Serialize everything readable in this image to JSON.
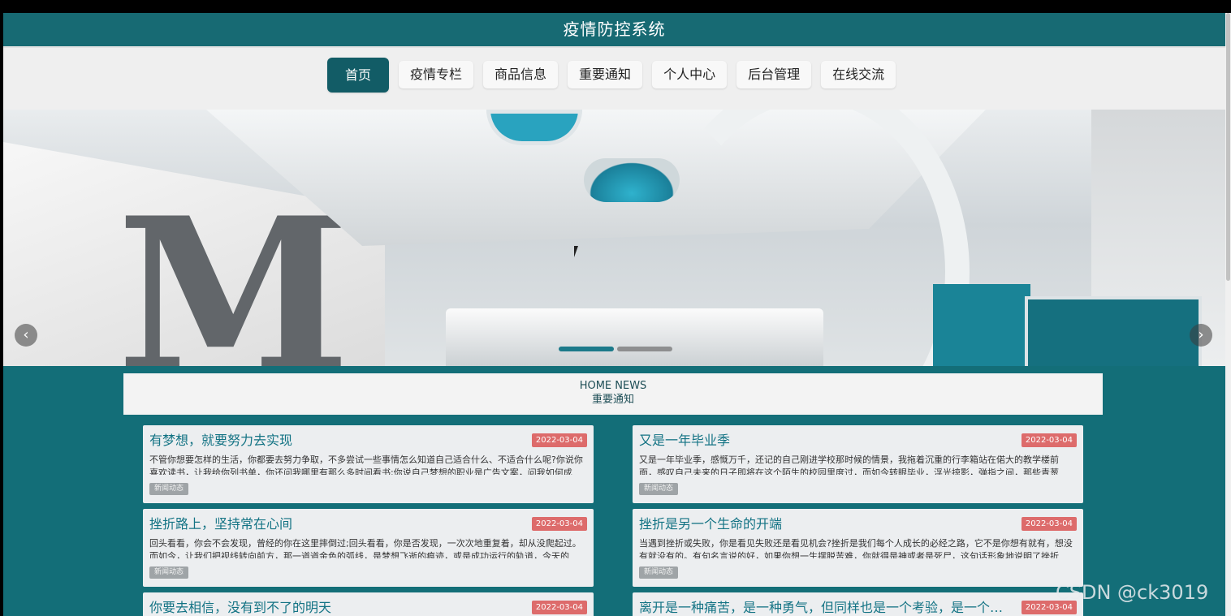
{
  "app": {
    "title": "疫情防控系统"
  },
  "nav": {
    "items": [
      {
        "label": "首页",
        "active": true
      },
      {
        "label": "疫情专栏"
      },
      {
        "label": "商品信息"
      },
      {
        "label": "重要通知"
      },
      {
        "label": "个人中心"
      },
      {
        "label": "后台管理"
      },
      {
        "label": "在线交流"
      }
    ]
  },
  "banner": {
    "prev_icon": "chevron-left-icon",
    "next_icon": "chevron-right-icon",
    "prev_glyph": "‹",
    "next_glyph": "›",
    "indicators": 2,
    "active_indicator": 1
  },
  "section": {
    "en_title": "HOME NEWS",
    "cn_title": "重要通知"
  },
  "news": [
    {
      "title": "有梦想，就要努力去实现",
      "date": "2022-03-04",
      "desc": "不管你想要怎样的生活，你都要去努力争取，不多尝试一些事情怎么知道自己适合什么、不适合什么呢?你说你喜欢读书，让我给你列书单，你还问我哪里有那么多时间看书;你说自己梦想的职业是广告文案，问我如何成",
      "tag": "新闻动态"
    },
    {
      "title": "又是一年毕业季",
      "date": "2022-03-04",
      "desc": "又是一年毕业季，感慨万千，还记的自己刚进学校那时候的情景，我拖着沉重的行李箱站在偌大的教学楼前面，感叹自己未来的日子即将在这个陌生的校园里度过，而如今转眼毕业，浮光掠影，弹指之间，那些青葱",
      "tag": "新闻动态"
    },
    {
      "title": "挫折路上，坚持常在心间",
      "date": "2022-03-04",
      "desc": "回头看看，你会不会发现，曾经的你在这里摔倒过;回头看看，你是否发现，一次次地重复着，却从没爬起过。而如今，让我们把视线转向前方，那一道道金色的弧线，是梦想飞逝的痕迹，或是成功运行的轨道，今天的",
      "tag": "新闻动态"
    },
    {
      "title": "挫折是另一个生命的开端",
      "date": "2022-03-04",
      "desc": "当遇到挫折或失败，你是看见失败还是看见机会?挫折是我们每个人成长的必经之路，它不是你想有就有，想没有就没有的。有句名言说的好，如果你想一生摆脱苦难，你就得是神或者是死尸，这句话形象地说明了挫折",
      "tag": "新闻动态"
    },
    {
      "title": "你要去相信，没有到不了的明天",
      "date": "2022-03-04",
      "desc": "",
      "tag": ""
    },
    {
      "title": "离开是一种痛苦，是一种勇气，但同样也是一个考验，是一个新的...",
      "date": "2022-03-04",
      "desc": "",
      "tag": ""
    }
  ],
  "watermark": "CSDN @ck3019"
}
